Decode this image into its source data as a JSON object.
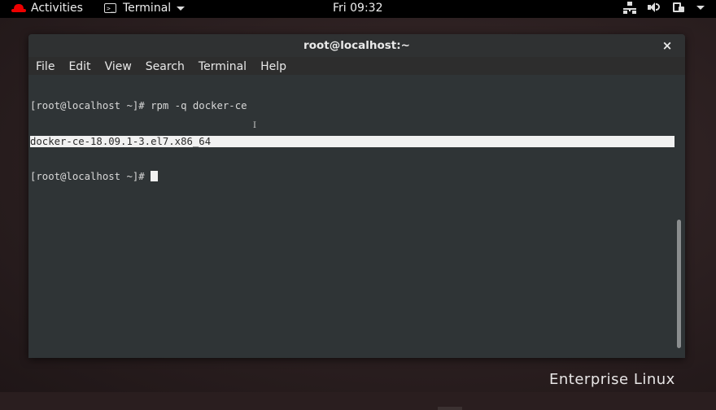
{
  "topbar": {
    "activities_label": "Activities",
    "app_menu_label": "Terminal",
    "clock": "Fri 09:32",
    "icons": [
      "redhat-icon",
      "terminal-icon",
      "chevron-down-icon",
      "network-icon",
      "volume-icon",
      "battery-icon",
      "chevron-down-icon"
    ]
  },
  "window": {
    "title": "root@localhost:~",
    "close_glyph": "×",
    "menu": [
      "File",
      "Edit",
      "View",
      "Search",
      "Terminal",
      "Help"
    ],
    "terminal_lines": [
      "[root@localhost ~]# rpm -q docker-ce",
      "docker-ce-18.09.1-3.el7.x86_64",
      "[root@localhost ~]# "
    ],
    "selected_line_index": 1
  },
  "desktop": {
    "wallpaper_text": "Enterprise Linux"
  },
  "colors": {
    "brand_red": "#ee0000",
    "terminal_bg": "#2f3436",
    "terminal_fg": "#d8d8d8"
  }
}
